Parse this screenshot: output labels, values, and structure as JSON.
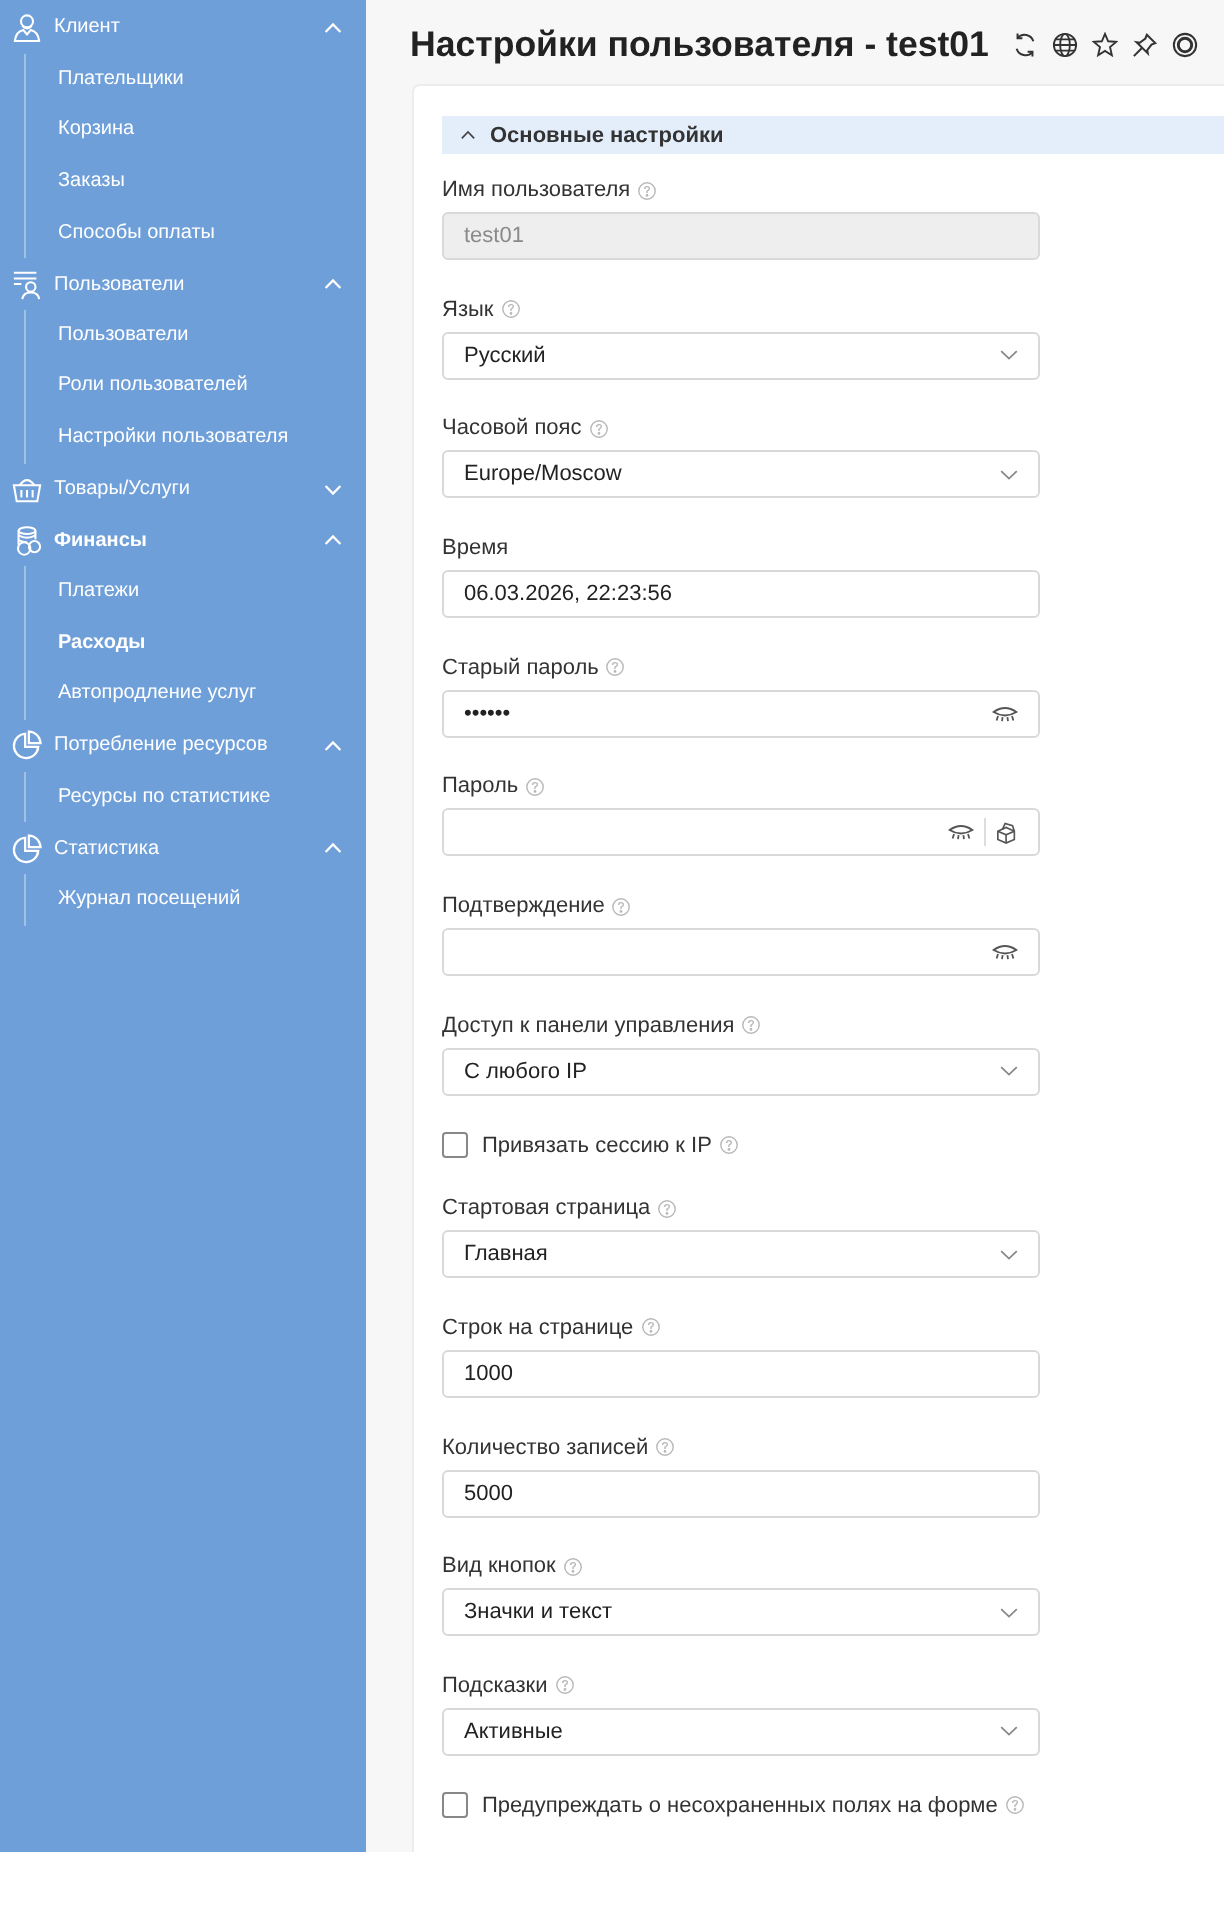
{
  "sidebar": {
    "groups": [
      {
        "label": "Клиент",
        "expanded": true,
        "selected": false,
        "children": [
          {
            "label": "Плательщики",
            "selected": false
          },
          {
            "label": "Корзина",
            "selected": false
          },
          {
            "label": "Заказы",
            "selected": false
          },
          {
            "label": "Способы оплаты",
            "selected": false
          }
        ]
      },
      {
        "label": "Пользователи",
        "expanded": true,
        "selected": false,
        "children": [
          {
            "label": "Пользователи",
            "selected": false
          },
          {
            "label": "Роли пользователей",
            "selected": false
          },
          {
            "label": "Настройки пользователя",
            "selected": false
          }
        ]
      },
      {
        "label": "Товары/Услуги",
        "expanded": false,
        "selected": false
      },
      {
        "label": "Финансы",
        "expanded": true,
        "selected": true,
        "children": [
          {
            "label": "Платежи",
            "selected": false
          },
          {
            "label": "Расходы",
            "selected": true
          },
          {
            "label": "Автопродление услуг",
            "selected": false
          }
        ]
      },
      {
        "label": "Потребление ресурсов",
        "expanded": true,
        "selected": false,
        "children": [
          {
            "label": "Ресурсы по статистике",
            "selected": false
          }
        ]
      },
      {
        "label": "Статистика",
        "expanded": true,
        "selected": false,
        "children": [
          {
            "label": "Журнал посещений",
            "selected": false
          }
        ]
      }
    ]
  },
  "page": {
    "title": "Настройки пользователя - test01"
  },
  "section": {
    "title": "Основные настройки",
    "expanded": true
  },
  "fields": [
    {
      "kind": "text",
      "label": "Имя пользователя",
      "help": true,
      "value": "test01",
      "disabled": true
    },
    {
      "kind": "select",
      "label": "Язык",
      "help": true,
      "value": "Русский"
    },
    {
      "kind": "select",
      "label": "Часовой пояс",
      "help": true,
      "value": "Europe/Moscow"
    },
    {
      "kind": "text",
      "label": "Время",
      "help": false,
      "value": "06.03.2026, 22:23:56",
      "disabled": false
    },
    {
      "kind": "password",
      "label": "Старый пароль",
      "help": true,
      "value": "••••••",
      "generator": false
    },
    {
      "kind": "password",
      "label": "Пароль",
      "help": true,
      "generator": true
    },
    {
      "kind": "password",
      "label": "Подтверждение",
      "help": true,
      "generator": false
    },
    {
      "kind": "select",
      "label": "Доступ к панели управления",
      "help": true,
      "value": "С любого IP"
    },
    {
      "kind": "checkbox",
      "label": "Привязать сессию к IP",
      "help": true,
      "checked": false
    },
    {
      "kind": "select",
      "label": "Стартовая страница",
      "help": true,
      "value": "Главная"
    },
    {
      "kind": "text",
      "label": "Строк на странице",
      "help": true,
      "value": "1000",
      "disabled": false
    },
    {
      "kind": "text",
      "label": "Количество записей",
      "help": true,
      "value": "5000",
      "disabled": false
    },
    {
      "kind": "select",
      "label": "Вид кнопок",
      "help": true,
      "value": "Значки и текст"
    },
    {
      "kind": "select",
      "label": "Подсказки",
      "help": true,
      "value": "Активные"
    },
    {
      "kind": "checkbox",
      "label": "Предупреждать о несохраненных полях на форме",
      "help": true,
      "checked": false
    }
  ]
}
